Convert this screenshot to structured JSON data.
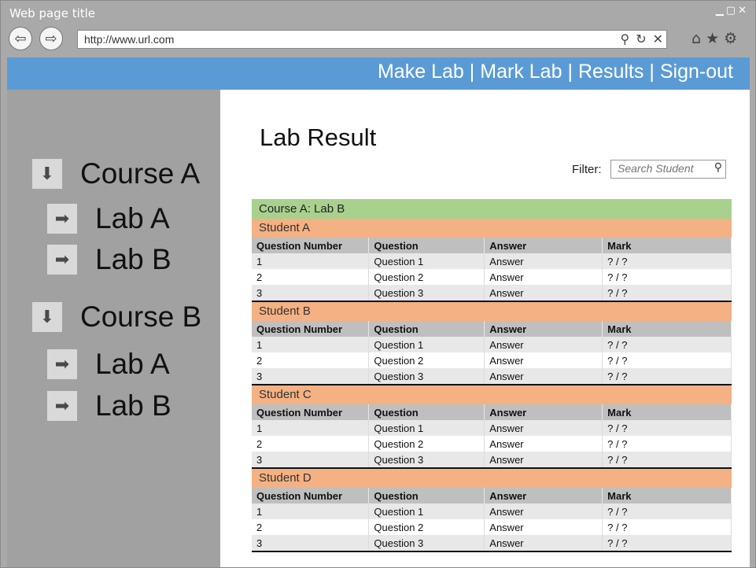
{
  "window": {
    "title": "Web page title",
    "url": "http://www.url.com"
  },
  "nav": {
    "links": [
      "Make Lab",
      "Mark Lab",
      "Results",
      "Sign-out"
    ]
  },
  "sidebar": {
    "courses": [
      {
        "label": "Course A",
        "labs": [
          "Lab A",
          "Lab B"
        ]
      },
      {
        "label": "Course B",
        "labs": [
          "Lab A",
          "Lab B"
        ]
      }
    ]
  },
  "main": {
    "title": "Lab Result",
    "filter_label": "Filter:",
    "filter_placeholder": "Search Student",
    "group_header": "Course A: Lab B",
    "columns": [
      "Question Number",
      "Question",
      "Answer",
      "Mark"
    ],
    "students": [
      {
        "name": "Student A",
        "rows": [
          [
            "1",
            "Question 1",
            "Answer",
            "? / ?"
          ],
          [
            "2",
            "Question 2",
            "Answer",
            "? / ?"
          ],
          [
            "3",
            "Question 3",
            "Answer",
            "? / ?"
          ]
        ]
      },
      {
        "name": "Student B",
        "rows": [
          [
            "1",
            "Question 1",
            "Answer",
            "? / ?"
          ],
          [
            "2",
            "Question 2",
            "Answer",
            "? / ?"
          ],
          [
            "3",
            "Question 3",
            "Answer",
            "? / ?"
          ]
        ]
      },
      {
        "name": "Student C",
        "rows": [
          [
            "1",
            "Question 1",
            "Answer",
            "? / ?"
          ],
          [
            "2",
            "Question 2",
            "Answer",
            "? / ?"
          ],
          [
            "3",
            "Question 3",
            "Answer",
            "? / ?"
          ]
        ]
      },
      {
        "name": "Student D",
        "rows": [
          [
            "1",
            "Question 1",
            "Answer",
            "? / ?"
          ],
          [
            "2",
            "Question 2",
            "Answer",
            "? / ?"
          ],
          [
            "3",
            "Question 3",
            "Answer",
            "? / ?"
          ]
        ]
      }
    ]
  },
  "colors": {
    "nav": "#5b9bd5",
    "group": "#a9d18e",
    "student": "#f4b183",
    "sidebar": "#a1a1a1"
  }
}
